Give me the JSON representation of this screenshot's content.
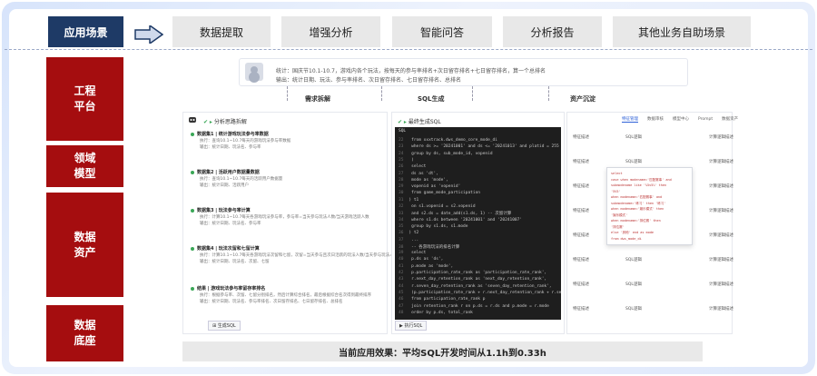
{
  "top": {
    "scene_label": "应用场景",
    "tabs": [
      "数据提取",
      "增强分析",
      "智能问答",
      "分析报告",
      "其他业务自助场景"
    ]
  },
  "side": [
    "工程\n平台",
    "领域\n模型",
    "数据\n资产",
    "数据\n底座"
  ],
  "prompt": {
    "line1": "统计：国庆节10.1-10.7，游戏内各个玩法，按每天的参与率排名+次日留存排名+七日留存排名，算一个总排名",
    "line2": "输出：统计日期、玩法、参与率排名、次日留存排名、七日留存排名、总排名"
  },
  "flow": {
    "split": "需求拆解",
    "sql": "SQL生成",
    "asset": "资产沉淀"
  },
  "left_panel": {
    "header": "分析思路拆解",
    "steps": [
      {
        "title": "数据集1 | 统计游戏玩法参与率数据",
        "lines": [
          "执行：查询10.1~10.7每天的游戏玩法参与率数据",
          "输出：统计日期、玩法名、参与率"
        ]
      },
      {
        "title": "数据集2 | 活跃用户数据量数据",
        "lines": [
          "执行：查询10.1~10.7每天的活跃用户数据量",
          "输出：统计日期、活跃用户"
        ]
      },
      {
        "title": "数据集3 | 玩法参与率计算",
        "lines": [
          "执行：计算10.1~10.7每天各游戏玩法参与率，参与率=当天参与玩法人数/当天游戏活跃人数",
          "输出：统计日期、玩法名、参与率"
        ]
      },
      {
        "title": "数据集4 | 玩法次留和七留计算",
        "lines": [
          "执行：计算10.1~10.7每天各游戏玩法次留和七留，次留=当天参与且次日活跃的玩法人数/当天参与玩法人数",
          "输出：统计日期、玩法名、次留、七留"
        ]
      },
      {
        "title": "结果 | 游戏玩法参与率留存率排名",
        "lines": [
          "执行：根据参与率、次留、七留分别排名，然后计算综合排名，最后根据综合名次得到最终排序",
          "输出：统计日期、玩法名、参与率排名、次日留存排名、七日留存排名、总排名"
        ]
      }
    ],
    "button": "生成SQL"
  },
  "mid_panel": {
    "header": "最终生成SQL",
    "code_label": "SQL",
    "lines": [
      {
        "n": "22",
        "t": "    from xxxtrack.dws_demo_core_mode_di"
      },
      {
        "n": "23",
        "t": "    where ds >= '20241001' and ds <= '20241013' and platid = 255"
      },
      {
        "n": "24",
        "t": "    group by ds, sub_mode_id, vopenid"
      },
      {
        "n": "25",
        "t": "  )"
      },
      {
        "n": "26",
        "t": "  select"
      },
      {
        "n": "27",
        "t": "    ds as 'dt',"
      },
      {
        "n": "28",
        "t": "    mode as 'mode',"
      },
      {
        "n": "29",
        "t": "    vopenid as 'vopenid'"
      },
      {
        "n": "30",
        "t": "  from game_mode_participation"
      },
      {
        "n": "31",
        "t": ") t1"
      },
      {
        "n": "32",
        "t": "  on s1.vopenid = s2.vopenid"
      },
      {
        "n": "33",
        "t": "  and s2.ds = date_add(s1.ds, 1)  -- 次留计算"
      },
      {
        "n": "34",
        "t": "  where s1.ds between '20241001' and '20241007'"
      },
      {
        "n": "35",
        "t": "  group by s1.ds, s1.mode"
      },
      {
        "n": "36",
        "t": ") t2"
      },
      {
        "n": "37",
        "t": "  ..."
      },
      {
        "n": "38",
        "t": "  -- 各游戏玩法的排名计算"
      },
      {
        "n": "39",
        "t": "  select"
      },
      {
        "n": "40",
        "t": "    p.ds as 'ds',"
      },
      {
        "n": "41",
        "t": "    p.mode as 'mode',"
      },
      {
        "n": "42",
        "t": "    p.participation_rate_rank as 'participation_rate_rank',"
      },
      {
        "n": "43",
        "t": "    r.next_day_retention_rank as 'next_day_retention_rank',"
      },
      {
        "n": "44",
        "t": "    r.seven_day_retention_rank as 'seven_day_retention_rank',"
      },
      {
        "n": "45",
        "t": "    (p.participation_rate_rank + r.next_day_retention_rank + r.se"
      },
      {
        "n": "46",
        "t": "  from participation_rate_rank p"
      },
      {
        "n": "47",
        "t": "  join retention_rank r on p.ds = r.ds and p.mode = r.mode"
      },
      {
        "n": "48",
        "t": "  order by p.ds, total_rank"
      }
    ],
    "button": "执行SQL"
  },
  "right_panel": {
    "tabs": [
      "特征管理",
      "数据审核",
      "模型中心",
      "Prompt",
      "数据资产"
    ],
    "rows": [
      {
        "c1": "特征描述",
        "c2": "SQL逻辑",
        "c3": "计算逻辑描述"
      },
      {
        "c1": "特征描述",
        "c2": "SQL逻辑",
        "c3": "计算逻辑描述"
      },
      {
        "c1": "特征描述",
        "c2": "SQL逻辑",
        "c3": "计算逻辑描述"
      },
      {
        "c1": "特征描述",
        "c2": "SQL逻辑",
        "c3": "计算逻辑描述"
      },
      {
        "c1": "特征描述",
        "c2": "SQL逻辑",
        "c3": "计算逻辑描述"
      },
      {
        "c1": "特征描述",
        "c2": "SQL逻辑",
        "c3": "计算逻辑描述"
      },
      {
        "c1": "特征描述",
        "c2": "SQL逻辑",
        "c3": "计算逻辑描述"
      },
      {
        "c1": "特征描述",
        "c2": "SQL逻辑",
        "c3": "计算逻辑描述"
      }
    ],
    "popup_lines": [
      "select",
      "  case when modename='匹配赛事' and",
      "  submodename like '%5v5%' then",
      "  '5V5'",
      "  when modename='匹配赛事' and",
      "  submodename='练习' then '练习'",
      "  when modename='娱乐模式' then",
      "  '娱乐模式'",
      "  when modename='排位赛' then",
      "  '排位赛'",
      "  else '其他' end as mode",
      "from dws_mode_di"
    ]
  },
  "bottom": "当前应用效果：平均SQL开发时间从1.1h到0.33h"
}
